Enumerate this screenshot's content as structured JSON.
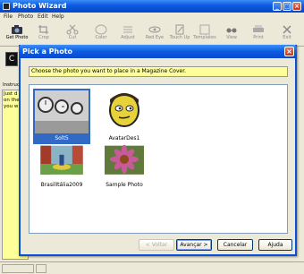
{
  "main_window": {
    "title": "Photo Wizard",
    "controls": {
      "minimize": "_",
      "maximize": "□",
      "close": "×"
    },
    "menu": [
      "File",
      "Photo",
      "Edit",
      "Help"
    ],
    "toolbar": [
      {
        "label": "Get Photo",
        "icon": "camera-icon"
      },
      {
        "label": "Crop",
        "icon": "crop-icon"
      },
      {
        "label": "Cut",
        "icon": "scissors-icon"
      },
      {
        "label": "Color",
        "icon": "palette-icon"
      },
      {
        "label": "Adjust",
        "icon": "sliders-icon"
      },
      {
        "label": "Red Eye",
        "icon": "eye-icon"
      },
      {
        "label": "Touch Up",
        "icon": "pencil-icon"
      },
      {
        "label": "Templates",
        "icon": "template-icon"
      },
      {
        "label": "View",
        "icon": "glasses-icon"
      },
      {
        "label": "Print",
        "icon": "printer-icon"
      },
      {
        "label": "Exit",
        "icon": "close-icon"
      }
    ],
    "instructions_label": "Instruc",
    "instructions_text": "Just d on the you w"
  },
  "dialog": {
    "title": "Pick a Photo",
    "prompt": "Choose the photo you want to place in a Magazine Cover.",
    "photos": [
      {
        "name": "Solt5",
        "selected": true
      },
      {
        "name": "AvatarDes1",
        "selected": false
      },
      {
        "name": "BrasilItália2009",
        "selected": false
      },
      {
        "name": "Sample Photo",
        "selected": false
      }
    ],
    "buttons": {
      "back": "< Voltar",
      "next": "Avançar >",
      "cancel": "Cancelar",
      "help": "Ajuda"
    }
  }
}
